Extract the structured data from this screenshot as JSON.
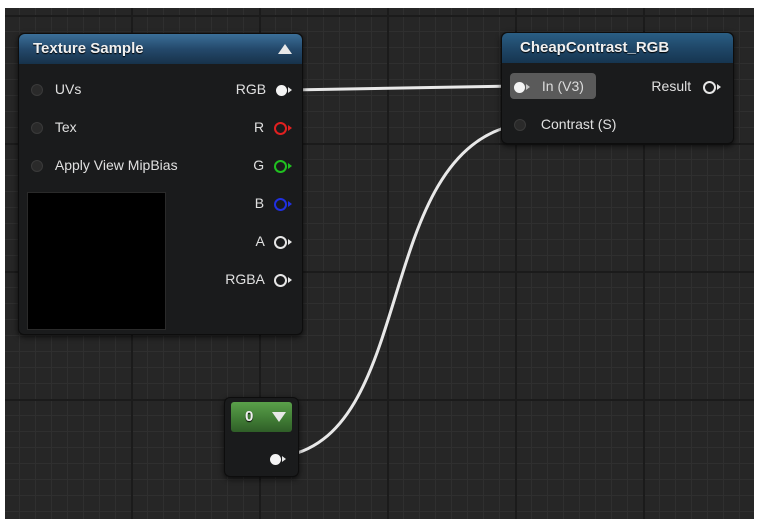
{
  "texture_sample": {
    "title": "Texture Sample",
    "inputs": [
      "UVs",
      "Tex",
      "Apply View MipBias"
    ],
    "outputs": [
      {
        "label": "RGB",
        "color": "#ffffff"
      },
      {
        "label": "R",
        "color": "#e02020"
      },
      {
        "label": "G",
        "color": "#20c020"
      },
      {
        "label": "B",
        "color": "#2030e0"
      },
      {
        "label": "A",
        "color": "#e6e6e6"
      },
      {
        "label": "RGBA",
        "color": "#e6e6e6"
      }
    ]
  },
  "cheap_contrast": {
    "title": "CheapContrast_RGB",
    "inputs": [
      "In (V3)",
      "Contrast (S)"
    ],
    "output": "Result"
  },
  "constant": {
    "value": "0"
  },
  "colors": {
    "graph_bg": "#262626",
    "wire": "#e8e8e8",
    "texture_header": "#2f5f86",
    "function_header": "#24507a",
    "constant_header": "#4b8c3e"
  }
}
